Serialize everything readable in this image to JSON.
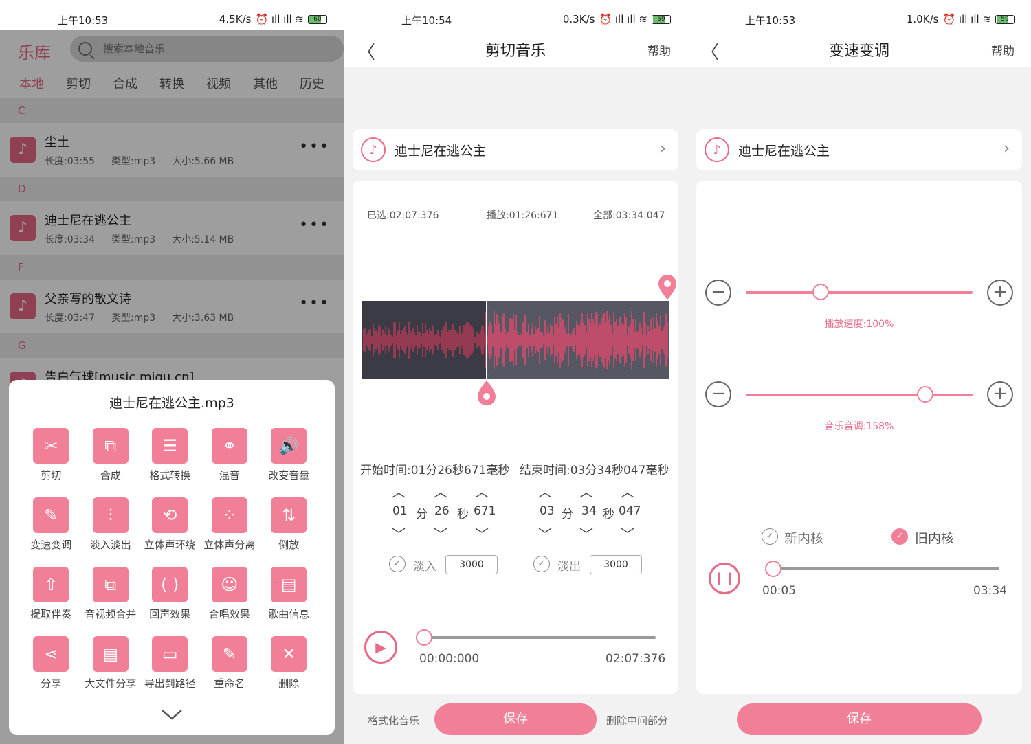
{
  "status": [
    {
      "time": "上午10:53",
      "speed": "4.5K/s",
      "battery": "60"
    },
    {
      "time": "上午10:54",
      "speed": "0.3K/s",
      "battery": "59"
    },
    {
      "time": "上午10:53",
      "speed": "1.0K/s",
      "battery": "59"
    }
  ],
  "library": {
    "logo": "乐库",
    "search_placeholder": "搜索本地音乐",
    "tabs": [
      "本地",
      "剪切",
      "合成",
      "转换",
      "视频",
      "其他",
      "历史"
    ],
    "sections": [
      "C",
      "D",
      "F",
      "G"
    ],
    "songs": [
      {
        "title": "尘土",
        "length": "长度:03:55",
        "type": "类型:mp3",
        "size": "大小:5.66 MB"
      },
      {
        "title": "迪士尼在逃公主",
        "length": "长度:03:34",
        "type": "类型:mp3",
        "size": "大小:5.14 MB"
      },
      {
        "title": "父亲写的散文诗",
        "length": "长度:03:47",
        "type": "类型:mp3",
        "size": "大小:3.63 MB"
      },
      {
        "title": "告白气球[music.migu.cn]"
      }
    ],
    "sheet_title": "迪士尼在逃公主.mp3",
    "actions": [
      {
        "label": "剪切",
        "icon": "scissors-icon",
        "glyph": "✂"
      },
      {
        "label": "合成",
        "icon": "merge-icon",
        "glyph": "⧉"
      },
      {
        "label": "格式转换",
        "icon": "lines-icon",
        "glyph": "☰"
      },
      {
        "label": "混音",
        "icon": "mix-icon",
        "glyph": "⚭"
      },
      {
        "label": "改变音量",
        "icon": "volume-icon",
        "glyph": "🔊"
      },
      {
        "label": "变速变调",
        "icon": "wand-icon",
        "glyph": "✎"
      },
      {
        "label": "淡入淡出",
        "icon": "fade-icon",
        "glyph": "⫶"
      },
      {
        "label": "立体声环绕",
        "icon": "surround-icon",
        "glyph": "⟲"
      },
      {
        "label": "立体声分离",
        "icon": "split-icon",
        "glyph": "⁘"
      },
      {
        "label": "倒放",
        "icon": "reverse-icon",
        "glyph": "⇅"
      },
      {
        "label": "提取伴奏",
        "icon": "extract-icon",
        "glyph": "⇧"
      },
      {
        "label": "音视频合并",
        "icon": "av-merge-icon",
        "glyph": "⧉"
      },
      {
        "label": "回声效果",
        "icon": "echo-icon",
        "glyph": "( )"
      },
      {
        "label": "合唱效果",
        "icon": "chorus-icon",
        "glyph": "☺"
      },
      {
        "label": "歌曲信息",
        "icon": "info-icon",
        "glyph": "▤"
      },
      {
        "label": "分享",
        "icon": "share-icon",
        "glyph": "⋖"
      },
      {
        "label": "大文件分享",
        "icon": "bigfile-icon",
        "glyph": "▤"
      },
      {
        "label": "导出到路径",
        "icon": "folder-icon",
        "glyph": "▭"
      },
      {
        "label": "重命名",
        "icon": "edit-icon",
        "glyph": "✎"
      },
      {
        "label": "删除",
        "icon": "close-icon",
        "glyph": "✕"
      }
    ]
  },
  "cut": {
    "title": "剪切音乐",
    "help": "帮助",
    "song": "迪士尼在逃公主",
    "selected": "已选:02:07:376",
    "playing": "播放:01:26:671",
    "total": "全部:03:34:047",
    "start_caption": "开始时间:01分26秒671毫秒",
    "end_caption": "结束时间:03分34秒047毫秒",
    "start": {
      "min": "01",
      "sec": "26",
      "ms": "671"
    },
    "end": {
      "min": "03",
      "sec": "34",
      "ms": "047"
    },
    "unit_min": "分",
    "unit_sec": "秒",
    "fade_in_label": "淡入",
    "fade_in": "3000",
    "fade_out_label": "淡出",
    "fade_out": "3000",
    "time_start": "00:00:000",
    "time_end": "02:07:376",
    "btn_format": "格式化音乐",
    "btn_save": "保存",
    "btn_delete_mid": "删除中间部分"
  },
  "speed": {
    "title": "变速变调",
    "help": "帮助",
    "song": "迪士尼在逃公主",
    "speed_label": "播放速度:100%",
    "speed_level": 0.33,
    "pitch_label": "音乐音调:158%",
    "pitch_level": 0.79,
    "engine_new": "新内核",
    "engine_old": "旧内核",
    "time_start": "00:05",
    "time_end": "03:34",
    "btn_save": "保存"
  },
  "colors": {
    "accent": "#e76a86",
    "button": "#f07f97"
  }
}
